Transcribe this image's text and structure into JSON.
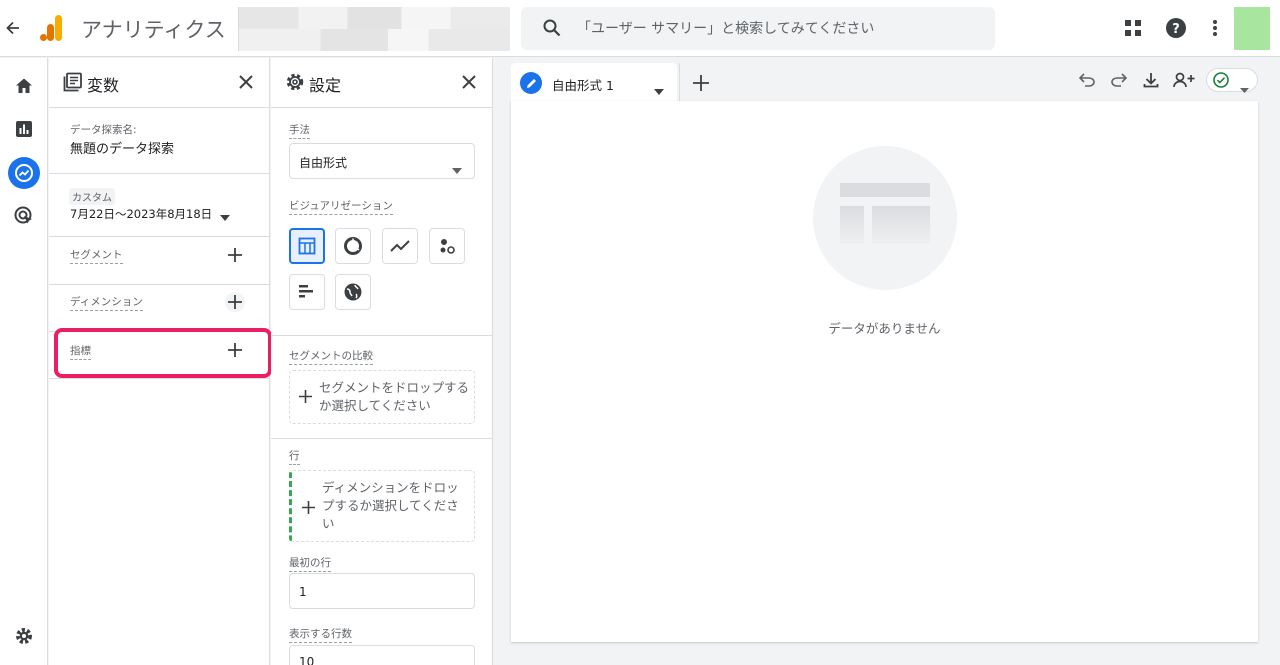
{
  "topbar": {
    "app_title": "アナリティクス",
    "search_placeholder": "「ユーザー サマリー」と検索してみてください"
  },
  "variables_panel": {
    "title": "変数",
    "exploration_name_label": "データ探索名:",
    "exploration_name": "無題のデータ探索",
    "date_chip": "カスタム",
    "date_range": "7月22日～2023年8月18日",
    "segments_label": "セグメント",
    "dimensions_label": "ディメンション",
    "metrics_label": "指標"
  },
  "settings_panel": {
    "title": "設定",
    "technique_label": "手法",
    "technique_value": "自由形式",
    "visualization_label": "ビジュアリゼーション",
    "segment_compare_label": "セグメントの比較",
    "segment_drop_text": "セグメントをドロップするか選択してください",
    "rows_label": "行",
    "rows_drop_text": "ディメンションをドロップするか選択してください",
    "first_row_label": "最初の行",
    "first_row_value": "1",
    "rows_count_label": "表示する行数",
    "rows_count_value": "10"
  },
  "canvas": {
    "tab_label": "自由形式 1",
    "empty_message": "データがありません"
  },
  "colors": {
    "accent": "#1a73e8",
    "highlight": "#ea1e63",
    "logo_orange": "#f9ab00",
    "logo_dark_orange": "#e37400"
  }
}
